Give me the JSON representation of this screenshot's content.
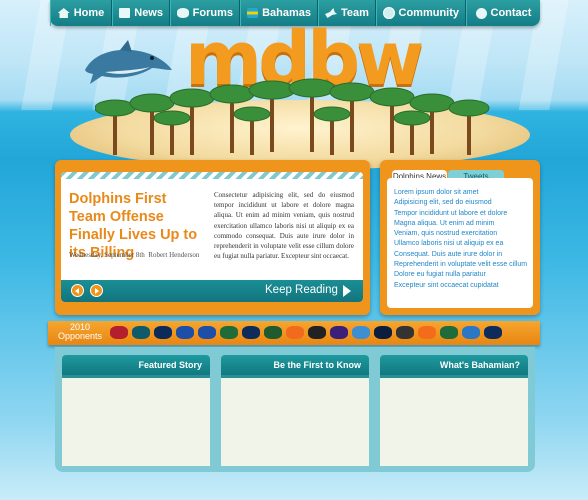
{
  "nav": {
    "items": [
      {
        "label": "Home",
        "icon": "home-icon"
      },
      {
        "label": "News",
        "icon": "news-icon"
      },
      {
        "label": "Forums",
        "icon": "forums-icon"
      },
      {
        "label": "Bahamas",
        "icon": "bahamas-flag-icon"
      },
      {
        "label": "Team",
        "icon": "team-icon"
      },
      {
        "label": "Community",
        "icon": "community-icon"
      },
      {
        "label": "Contact",
        "icon": "contact-icon"
      }
    ]
  },
  "site": {
    "logo": "mdbw"
  },
  "featured": {
    "headline": "Dolphins First Team Offense Finally Lives Up to its Billing",
    "date": "Wednesday, September 8th",
    "author": "Robert Henderson",
    "body": "Consectetur adipisicing elit, sed do eiusmod tempor incididunt ut labore et dolore magna aliqua. Ut enim ad minim veniam, quis nostrud exercitation ullamco laboris nisi ut aliquip ex ea commodo consequat. Duis aute irure dolor in reprehenderit in voluptate velit esse cillum dolore eu fugiat nulla pariatur. Excepteur sint occaecat.",
    "keep_reading": "Keep Reading"
  },
  "side": {
    "tabs": [
      "Dolphins News",
      "Tweets"
    ],
    "items": [
      "Lorem ipsum dolor sit amet",
      "Adipisicing elit, sed do eiusmod",
      "Tempor incididunt ut labore et dolore",
      "Magna aliqua. Ut enim ad minim",
      "Veniam, quis nostrud exercitation",
      "Ullamco laboris nisi ut aliquip ex ea",
      "Consequat. Duis aute irure dolor in",
      "Reprehenderit in voluptate velit esse cillum",
      "Dolore eu fugiat nulla pariatur",
      "Excepteur sint occaecat cupidatat"
    ]
  },
  "opponents": {
    "year": "2010",
    "label": "Opponents",
    "teams": [
      {
        "name": "buccaneers-icon",
        "color": "#b41f2e"
      },
      {
        "name": "jaguars-icon",
        "color": "#0f5b6b"
      },
      {
        "name": "cowboys-icon",
        "color": "#0c2a5a"
      },
      {
        "name": "bills-icon",
        "color": "#1e4fa8"
      },
      {
        "name": "bills-icon",
        "color": "#1e4fa8"
      },
      {
        "name": "jets-icon",
        "color": "#1f6b3a"
      },
      {
        "name": "patriots-icon",
        "color": "#0d2c5c"
      },
      {
        "name": "packers-icon",
        "color": "#1f5b2e"
      },
      {
        "name": "bengals-icon",
        "color": "#f26a1e"
      },
      {
        "name": "steelers-icon",
        "color": "#222222"
      },
      {
        "name": "ravens-icon",
        "color": "#3b2079"
      },
      {
        "name": "titans-icon",
        "color": "#3d8fd1"
      },
      {
        "name": "bears-icon",
        "color": "#0b1e3d"
      },
      {
        "name": "raiders-icon",
        "color": "#333333"
      },
      {
        "name": "browns-icon",
        "color": "#f46c1a"
      },
      {
        "name": "jets-icon",
        "color": "#1f6b3a"
      },
      {
        "name": "lions-icon",
        "color": "#2a78c5"
      },
      {
        "name": "patriots-icon",
        "color": "#0d2c5c"
      }
    ]
  },
  "columns": [
    {
      "title": "Featured Story"
    },
    {
      "title": "Be the First to Know"
    },
    {
      "title": "What's Bahamian?"
    }
  ]
}
